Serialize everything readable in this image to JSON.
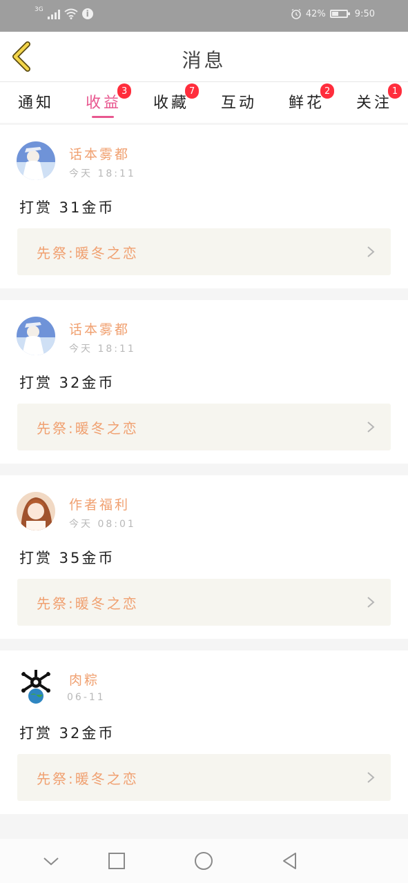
{
  "status_bar": {
    "network": "3G",
    "battery_percent": "42%",
    "time": "9:50"
  },
  "header": {
    "title": "消息"
  },
  "tabs": [
    {
      "label": "通知",
      "badge": ""
    },
    {
      "label": "收益",
      "badge": "3"
    },
    {
      "label": "收藏",
      "badge": "7"
    },
    {
      "label": "互动",
      "badge": ""
    },
    {
      "label": "鲜花",
      "badge": "2"
    },
    {
      "label": "关注",
      "badge": "1"
    }
  ],
  "active_tab": "收益",
  "colors": {
    "accent": "#e8578f",
    "username": "#f0a070",
    "badge": "#ff2d3c",
    "book_row_bg": "#f6f5ef"
  },
  "messages": [
    {
      "user": "话本雾都",
      "time": "今天  18:11",
      "text": "打赏 31金币",
      "book": "先祭:暖冬之恋",
      "avatar": "anime-avatar-blue"
    },
    {
      "user": "话本雾都",
      "time": "今天  18:11",
      "text": "打赏 32金币",
      "book": "先祭:暖冬之恋",
      "avatar": "anime-avatar-blue"
    },
    {
      "user": "作者福利",
      "time": "今天  08:01",
      "text": "打赏 35金币",
      "book": "先祭:暖冬之恋",
      "avatar": "anime-avatar-girl"
    },
    {
      "user": "肉粽",
      "time": "06-11",
      "text": "打赏 32金币",
      "book": "先祭:暖冬之恋",
      "avatar": "earth-avatar"
    }
  ],
  "nav_bar": {
    "icons": [
      "collapse-icon",
      "recent-apps-icon",
      "home-icon",
      "back-icon"
    ]
  }
}
